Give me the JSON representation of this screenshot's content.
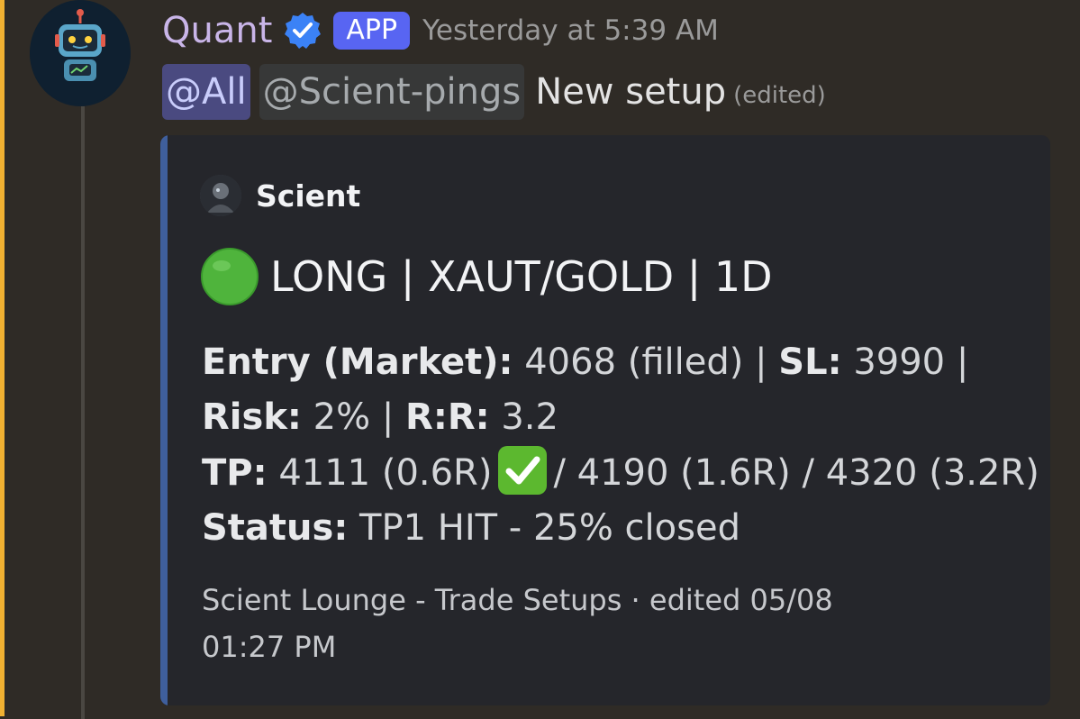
{
  "message": {
    "username": "Quant",
    "app_tag": "APP",
    "timestamp": "Yesterday at 5:39 AM",
    "mention_all": "@All",
    "mention_role": "@Scient-pings",
    "text": "New setup",
    "edited": "(edited)"
  },
  "embed": {
    "author": "Scient",
    "title": "LONG | XAUT/GOLD | 1D",
    "entry_label": "Entry (Market):",
    "entry_value": "4068 (filled) |",
    "sl_label": "SL:",
    "sl_value": "3990 |",
    "risk_label": "Risk:",
    "risk_value": "2% |",
    "rr_label": "R:R:",
    "rr_value": "3.2",
    "tp_label": "TP:",
    "tp1": "4111 (0.6R)",
    "tp_rest": "/ 4190 (1.6R) / 4320 (3.2R)",
    "status_label": "Status:",
    "status_value": "TP1 HIT - 25% closed",
    "footer": "Scient Lounge - Trade Setups · edited 05/08 01:27 PM"
  },
  "colors": {
    "mention_highlight": "#f0b132",
    "app_tag": "#5865f2",
    "embed_accent": "#3f5f9c",
    "username": "#c9b5e8"
  },
  "icons": [
    "robot-avatar-icon",
    "verified-badge-icon",
    "green-circle-icon",
    "check-mark-icon"
  ]
}
